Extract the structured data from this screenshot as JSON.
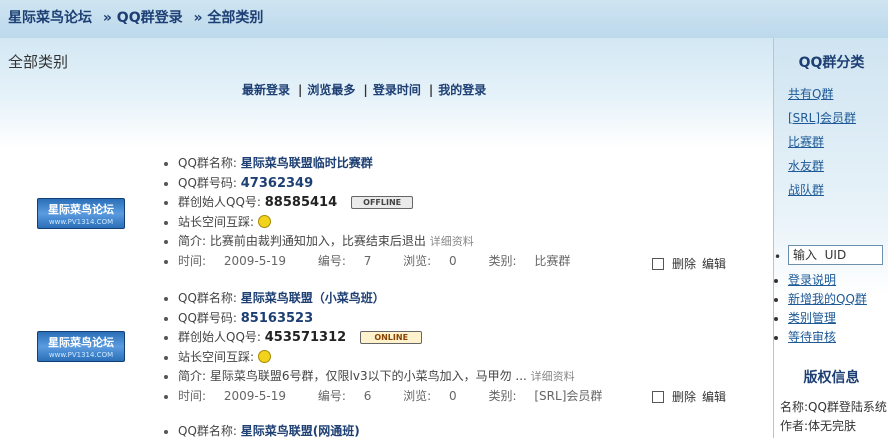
{
  "breadcrumb": {
    "site": "星际菜鸟论坛",
    "qq_login": "» QQ群登录",
    "all": "» 全部类别"
  },
  "page_title": "全部类别",
  "tabs": [
    "最新登录",
    "浏览最多",
    "登录时间",
    "我的登录"
  ],
  "badge": {
    "text": "星际菜鸟论坛",
    "url_text": "www.PV1314.COM"
  },
  "labels": {
    "name": "QQ群名称:",
    "number": "QQ群号码:",
    "founder": "群创始人QQ号:",
    "space": "站长空间互踩:",
    "intro": "简介:",
    "details": "详细资料",
    "time": "时间:",
    "id": "编号:",
    "views": "浏览:",
    "category": "类别:",
    "delete": "删除",
    "edit": "编辑"
  },
  "groups": [
    {
      "name": "星际菜鸟联盟临时比赛群",
      "number": "47362349",
      "founder": "88585414",
      "status": "OFFLINE",
      "intro": "比赛前由裁判通知加入，比赛结束后退出",
      "time": "2009-5-19",
      "id": "7",
      "views": "0",
      "category": "比赛群"
    },
    {
      "name": "星际菜鸟联盟（小菜鸟班）",
      "number": "85163523",
      "founder": "453571312",
      "status": "ONLINE",
      "intro": "星际菜鸟联盟6号群，仅限lv3以下的小菜鸟加入，马甲勿 ...",
      "time": "2009-5-19",
      "id": "6",
      "views": "0",
      "category": "[SRL]会员群"
    },
    {
      "name": "星际菜鸟联盟(网通班)"
    }
  ],
  "sidebar": {
    "title": "QQ群分类",
    "categories": [
      "共有Q群",
      "[SRL]会员群",
      "比赛群",
      "水友群",
      "战队群"
    ],
    "uid_placeholder": "输入  UID",
    "links": [
      "登录说明",
      "新增我的QQ群",
      "类别管理",
      "等待审核"
    ],
    "copyright_title": "版权信息",
    "copyright_name": "名称:QQ群登陆系统",
    "copyright_author": "作者:体无完肤"
  },
  "colors": {
    "brand": "#1d3f73",
    "link": "#1d5a97",
    "header_bg": "#cfe4f1"
  }
}
